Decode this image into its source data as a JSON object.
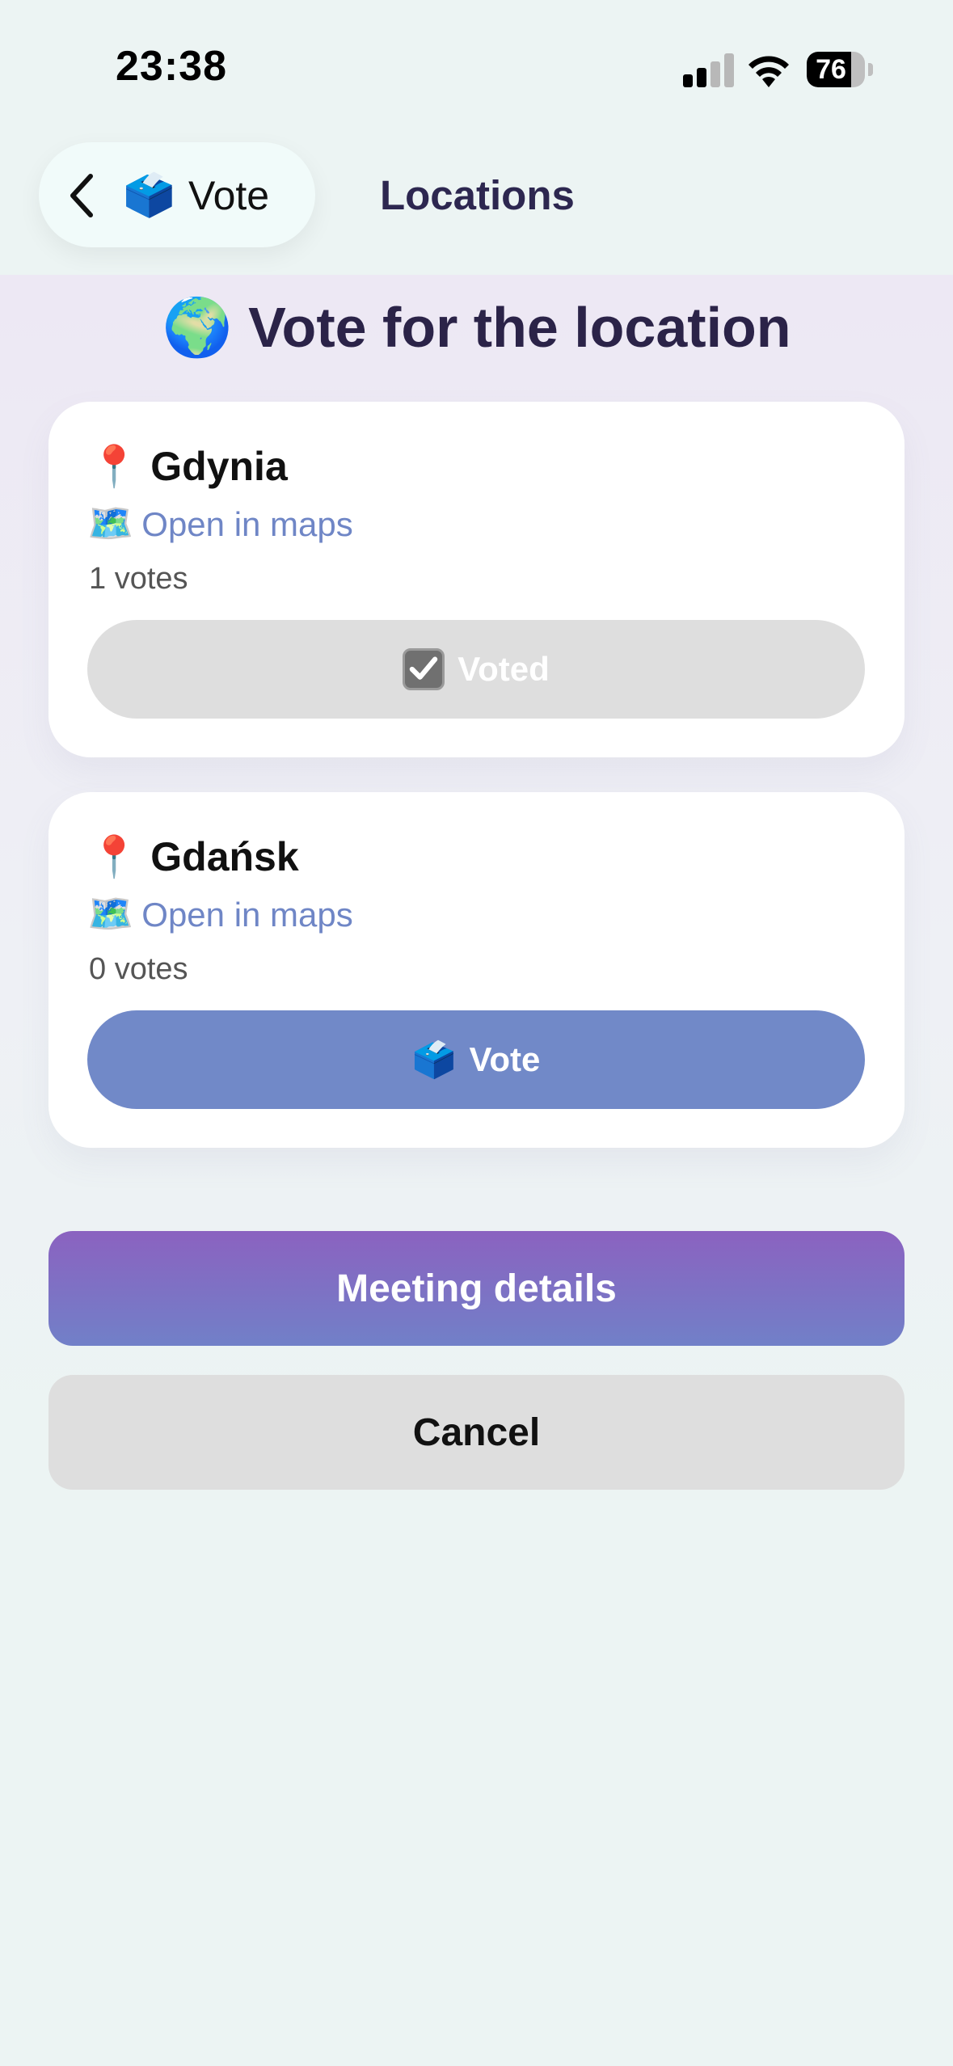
{
  "status_bar": {
    "time": "23:38",
    "battery_percent": "76",
    "battery_level": 0.76,
    "signal_icon": "cellular-signal-icon",
    "wifi_icon": "wifi-icon"
  },
  "nav": {
    "back_label": "Vote",
    "back_emoji": "🗳️",
    "title": "Locations"
  },
  "heading": {
    "emoji": "🌍",
    "text": "Vote for the location"
  },
  "locations": [
    {
      "pin": "📍",
      "name": "Gdynia",
      "maps_emoji": "🗺️",
      "maps_label": "Open in maps",
      "votes": "1 votes",
      "button_label": "Voted",
      "voted": true
    },
    {
      "pin": "📍",
      "name": "Gdańsk",
      "maps_emoji": "🗺️",
      "maps_label": "Open in maps",
      "votes": "0 votes",
      "button_emoji": "🗳️",
      "button_label": "Vote",
      "voted": false
    }
  ],
  "actions": {
    "details_label": "Meeting details",
    "cancel_label": "Cancel"
  },
  "colors": {
    "accent": "#7189c8",
    "title": "#2b2348",
    "link": "#6f86c6",
    "gradient_top": "#8b62c0",
    "gradient_bottom": "#7180c8"
  }
}
